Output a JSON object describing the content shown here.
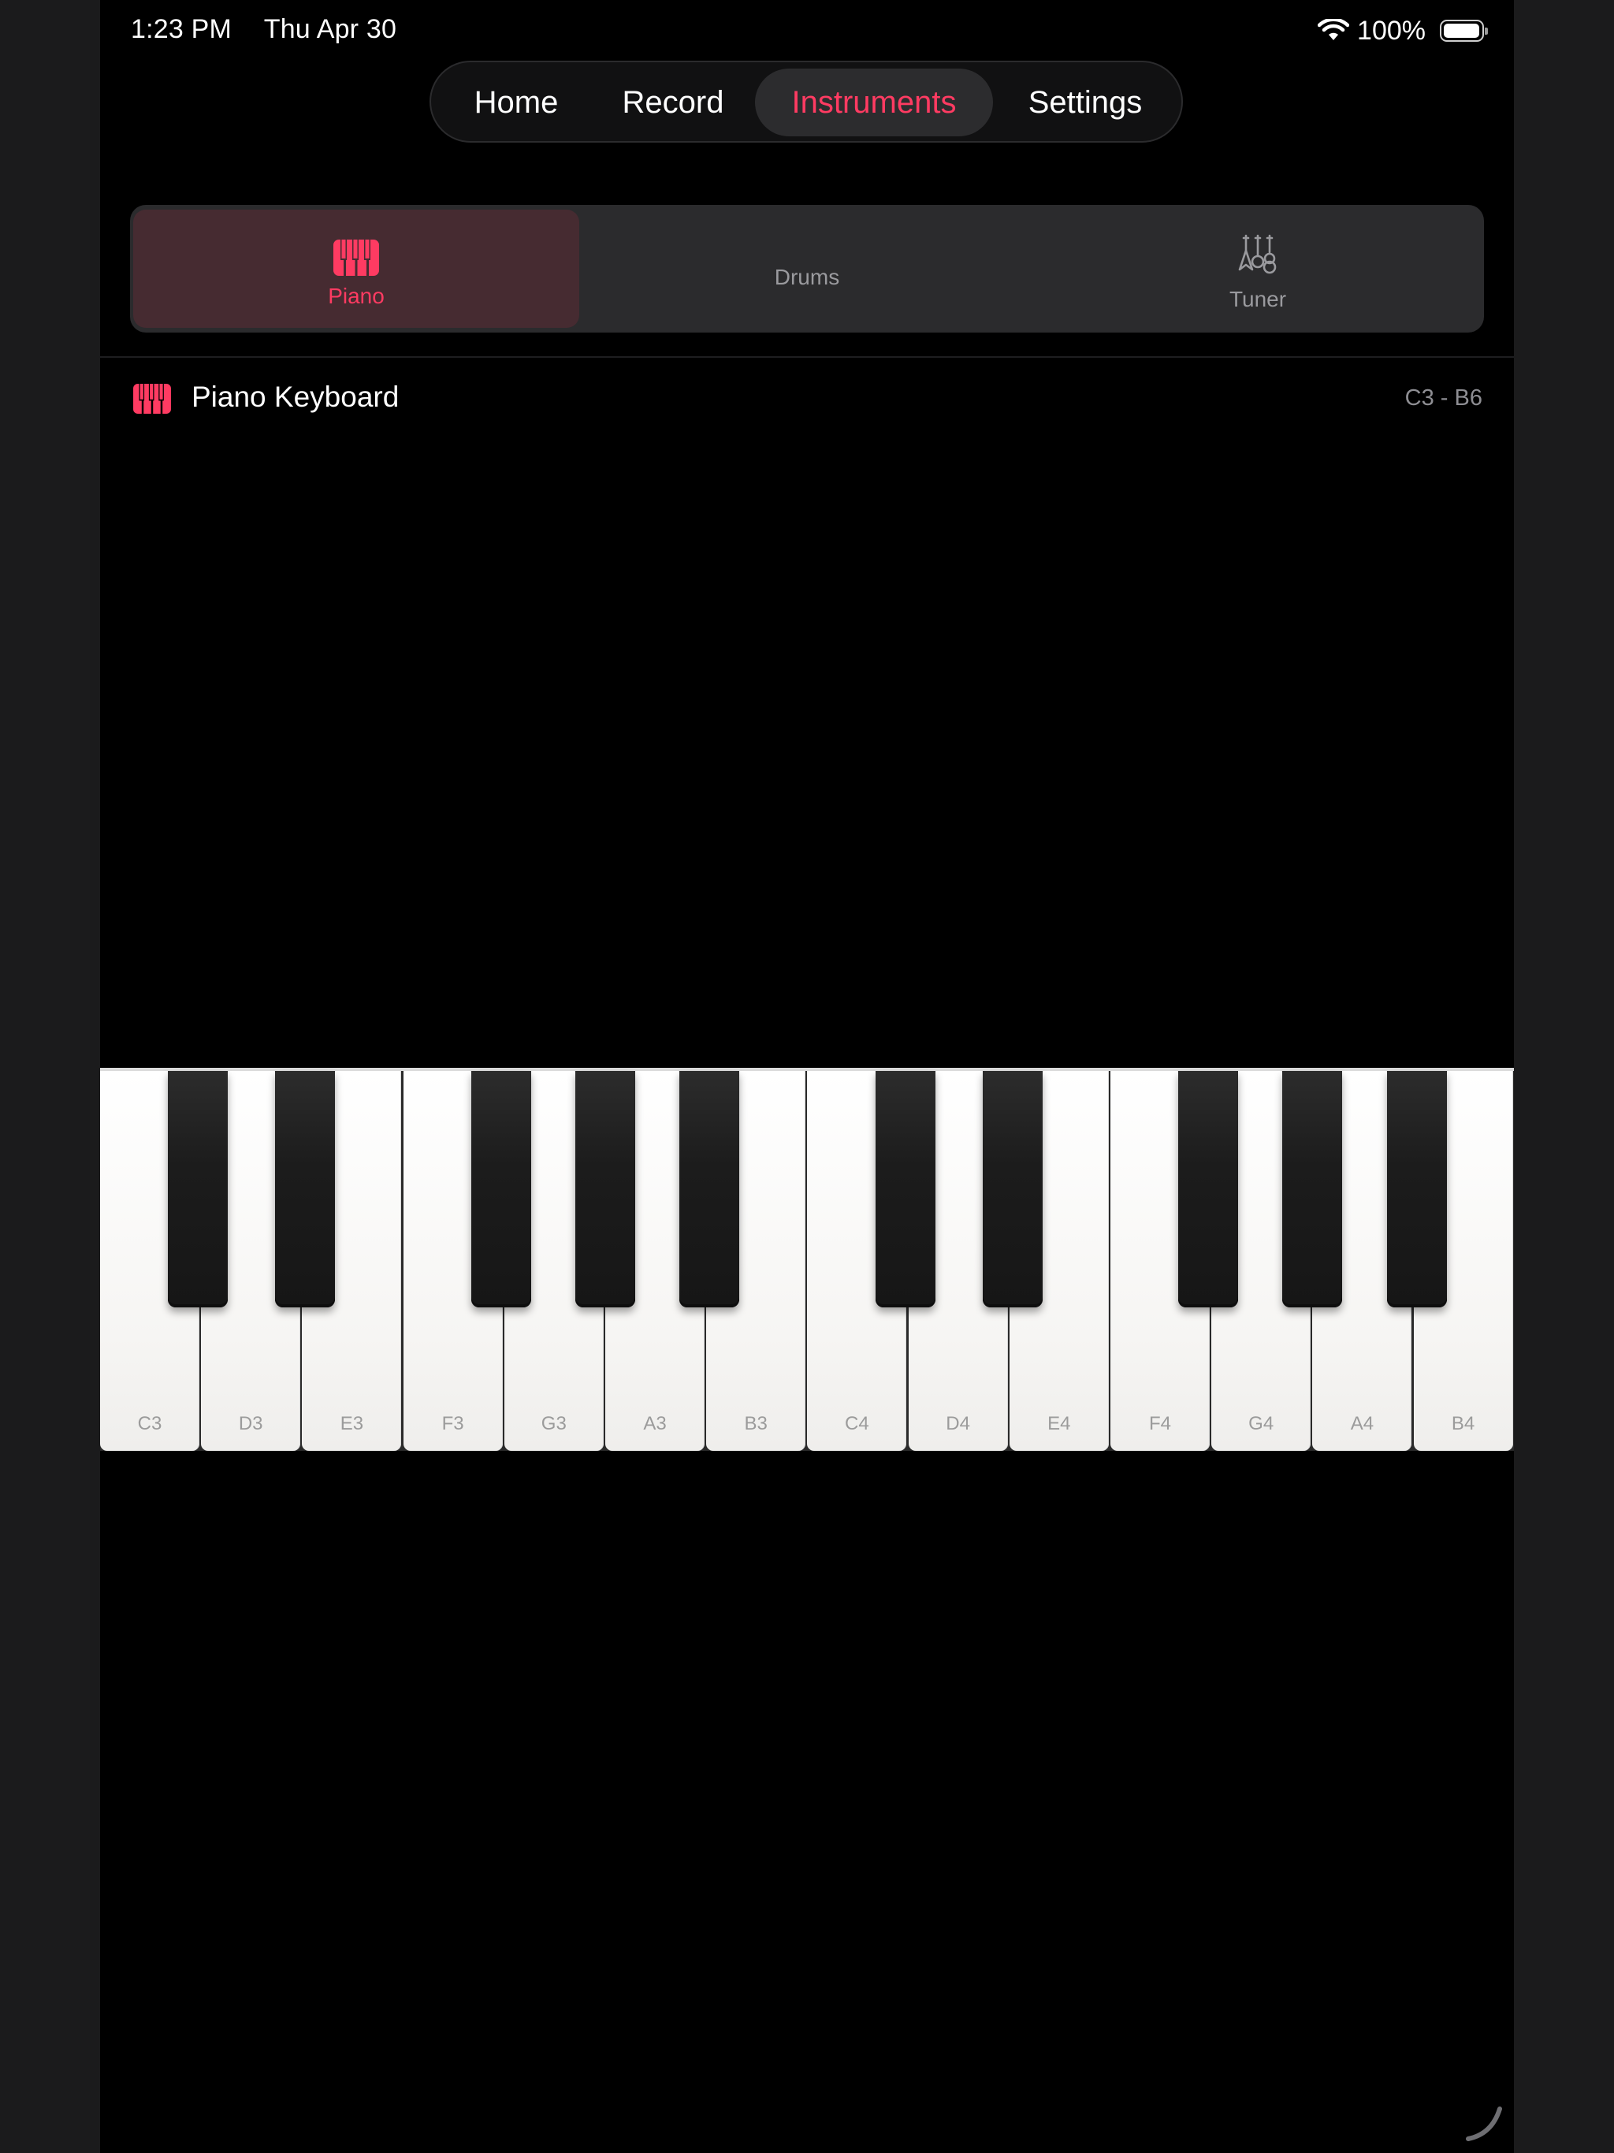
{
  "status": {
    "time": "1:23 PM",
    "date": "Thu Apr 30",
    "battery_text": "100%",
    "battery_level": 1.0
  },
  "nav": {
    "items": [
      "Home",
      "Record",
      "Instruments",
      "Settings"
    ],
    "active": "Instruments"
  },
  "instrument_tabs": {
    "items": [
      {
        "label": "Piano",
        "icon": "piano-icon"
      },
      {
        "label": "Drums",
        "icon": ""
      },
      {
        "label": "Tuner",
        "icon": "tuner-icon"
      }
    ],
    "active": "Piano"
  },
  "section": {
    "icon": "piano-icon",
    "title": "Piano Keyboard",
    "range": "C3 - B6"
  },
  "keyboard": {
    "white_keys": [
      "C3",
      "D3",
      "E3",
      "F3",
      "G3",
      "A3",
      "B3",
      "C4",
      "D4",
      "E4",
      "F4",
      "G4",
      "A4",
      "B4"
    ]
  },
  "colors": {
    "accent": "#ff3b62",
    "background": "#000000",
    "tab_active_bg": "#462b31",
    "surface": "#2b2b2d"
  }
}
